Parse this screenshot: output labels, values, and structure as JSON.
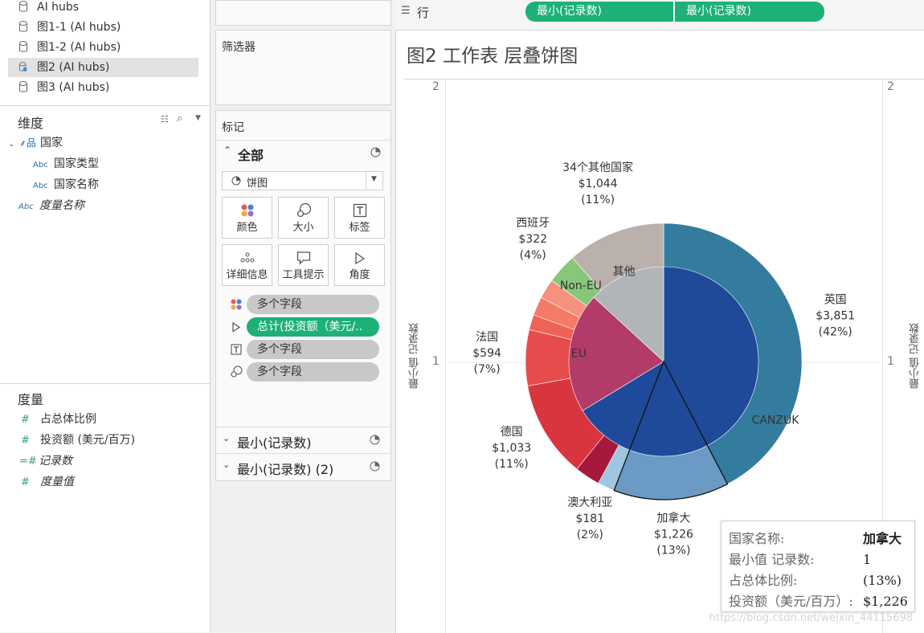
{
  "datasources": [
    {
      "label": "AI hubs",
      "selected": false
    },
    {
      "label": "图1-1 (AI hubs)",
      "selected": false
    },
    {
      "label": "图1-2 (AI hubs)",
      "selected": false
    },
    {
      "label": "图2 (AI hubs)",
      "selected": true
    },
    {
      "label": "图3 (AI hubs)",
      "selected": false
    }
  ],
  "dimensions": {
    "title": "维度",
    "group": "国家",
    "fields": [
      "国家类型",
      "国家名称",
      "度量名称"
    ]
  },
  "measures": {
    "title": "度量",
    "fields": [
      "占总体比例",
      "投资额 (美元/百万)",
      "记录数",
      "度量值"
    ]
  },
  "filters": {
    "title": "筛选器"
  },
  "marks": {
    "title": "标记",
    "all_label": "全部",
    "mark_type": "饼图",
    "buttons": [
      "颜色",
      "大小",
      "标签",
      "详细信息",
      "工具提示",
      "角度"
    ],
    "pills": [
      "多个字段",
      "总计(投资额（美元/..",
      "多个字段",
      "多个字段"
    ],
    "sections": [
      "最小(记录数)",
      "最小(记录数) (2)"
    ]
  },
  "rows_shelf": {
    "label": "行",
    "pills": [
      "最小(记录数)",
      "最小(记录数)"
    ]
  },
  "sheet": {
    "title": "图2 工作表 层叠饼图",
    "axis_title": "最小值 记录数",
    "ticks": [
      "2",
      "1"
    ]
  },
  "chart_data": {
    "type": "pie",
    "title": "图2 工作表 层叠饼图",
    "inner_ring": [
      {
        "name": "CANZUK",
        "value": 5258,
        "color": "#1f4a9a"
      },
      {
        "name": "EU",
        "value": 1627,
        "color": "#b33b6a"
      },
      {
        "name": "Non-EU",
        "value": 0,
        "color": "#a9d8a0"
      },
      {
        "name": "其他",
        "value": 1044,
        "color": "#b2b5b8"
      }
    ],
    "outer_ring": [
      {
        "name": "英国",
        "value": 3851,
        "label": "$3,851",
        "pct": "(42%)",
        "color": "#347c9e"
      },
      {
        "name": "加拿大",
        "value": 1226,
        "label": "$1,226",
        "pct": "(13%)",
        "color": "#6b9bc4"
      },
      {
        "name": "澳大利亚",
        "value": 181,
        "label": "$181",
        "pct": "(2%)",
        "color": "#9ec6e0"
      },
      {
        "name": "",
        "value": 270,
        "color": "#a8183c"
      },
      {
        "name": "德国",
        "value": 1033,
        "label": "$1,033",
        "pct": "(11%)",
        "color": "#d8353e"
      },
      {
        "name": "法国",
        "value": 594,
        "label": "$594",
        "pct": "(7%)",
        "color": "#e64c4c"
      },
      {
        "name": "",
        "value": 160,
        "color": "#ee6258"
      },
      {
        "name": "",
        "value": 200,
        "color": "#f47b68"
      },
      {
        "name": "",
        "value": 210,
        "color": "#f4927e"
      },
      {
        "name": "西班牙",
        "value": 322,
        "label": "$322",
        "pct": "(4%)",
        "color": "#88c77b"
      },
      {
        "name": "34个其他国家",
        "value": 1044,
        "label": "$1,044",
        "pct": "(11%)",
        "color": "#bab0ac"
      }
    ]
  },
  "tooltip": {
    "rows": [
      {
        "key": "国家名称:",
        "value": "加拿大"
      },
      {
        "key": "最小值 记录数:",
        "value": "1"
      },
      {
        "key": "占总体比例:",
        "value": "(13%)"
      },
      {
        "key": "投资额（美元/百万）:",
        "value": "$1,226"
      }
    ]
  },
  "watermark": "https://blog.csdn.net/weixin_44115698"
}
